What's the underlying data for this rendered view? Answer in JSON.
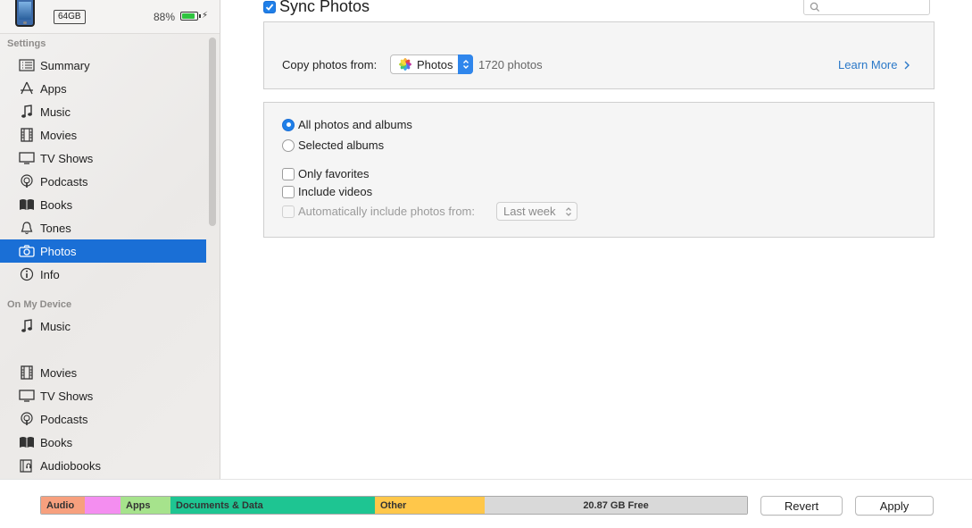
{
  "device": {
    "capacity": "64GB",
    "battery_percent": "88%",
    "battery_level": 0.88
  },
  "sidebar": {
    "settings_header": "Settings",
    "settings_items": [
      {
        "label": "Summary",
        "icon": "summary-icon"
      },
      {
        "label": "Apps",
        "icon": "apps-icon"
      },
      {
        "label": "Music",
        "icon": "music-note-icon"
      },
      {
        "label": "Movies",
        "icon": "film-icon"
      },
      {
        "label": "TV Shows",
        "icon": "tv-icon"
      },
      {
        "label": "Podcasts",
        "icon": "podcast-icon"
      },
      {
        "label": "Books",
        "icon": "book-icon"
      },
      {
        "label": "Tones",
        "icon": "bell-icon"
      },
      {
        "label": "Photos",
        "icon": "camera-icon",
        "selected": true
      },
      {
        "label": "Info",
        "icon": "info-icon"
      }
    ],
    "device_header": "On My Device",
    "device_items": [
      {
        "label": "Music",
        "icon": "music-note-icon"
      },
      {
        "label": "Movies",
        "icon": "film-icon"
      },
      {
        "label": "TV Shows",
        "icon": "tv-icon"
      },
      {
        "label": "Podcasts",
        "icon": "podcast-icon"
      },
      {
        "label": "Books",
        "icon": "book-icon"
      },
      {
        "label": "Audiobooks",
        "icon": "audiobook-icon"
      }
    ]
  },
  "main": {
    "sync_title": "Sync Photos",
    "sync_checked": true,
    "copy_from_label": "Copy photos from:",
    "source_selected": "Photos",
    "photo_count": "1720 photos",
    "learn_more": "Learn More",
    "options": {
      "all_photos": "All photos and albums",
      "selected_albums": "Selected albums",
      "only_favorites": "Only favorites",
      "include_videos": "Include videos",
      "auto_include": "Automatically include photos from:",
      "auto_include_value": "Last week"
    }
  },
  "storage": {
    "segments": [
      {
        "label": "Audio",
        "color": "#f7a07e",
        "fraction": 0.062
      },
      {
        "label": "",
        "color": "#f48ef0",
        "fraction": 0.05
      },
      {
        "label": "Apps",
        "color": "#a6e38c",
        "fraction": 0.071
      },
      {
        "label": "Documents & Data",
        "color": "#1ec592",
        "fraction": 0.29
      },
      {
        "label": "Other",
        "color": "#ffc74a",
        "fraction": 0.156
      }
    ],
    "free_label": "20.87 GB Free",
    "free_color": "#d9d9d9"
  },
  "buttons": {
    "revert": "Revert",
    "apply": "Apply"
  },
  "colors": {
    "selection": "#1a6fd6",
    "accent": "#2f86ec",
    "link": "#2a78c8"
  }
}
